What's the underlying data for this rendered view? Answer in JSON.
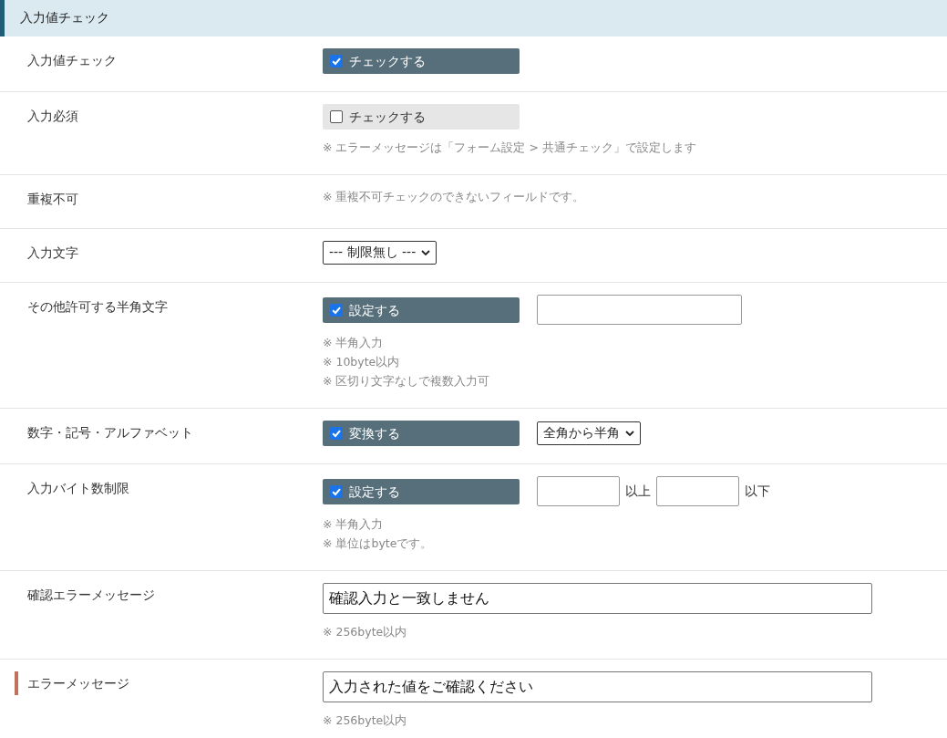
{
  "section": {
    "title": "入力値チェック"
  },
  "rows": [
    {
      "label": "入力値チェック",
      "required": false,
      "controls": [
        {
          "kind": "toggle",
          "label": "チェックする",
          "checked": true
        }
      ]
    },
    {
      "label": "入力必須",
      "required": false,
      "controls": [
        {
          "kind": "toggle",
          "label": "チェックする",
          "checked": false
        }
      ],
      "notes": [
        "※ エラーメッセージは「フォーム設定 > 共通チェック」で設定します"
      ]
    },
    {
      "label": "重複不可",
      "required": false,
      "notes": [
        "※ 重複不可チェックのできないフィールドです。"
      ]
    },
    {
      "label": "入力文字",
      "required": false,
      "controls": [
        {
          "kind": "select",
          "value": "--- 制限無し ---"
        }
      ]
    },
    {
      "label": "その他許可する半角文字",
      "required": false,
      "controls": [
        {
          "kind": "toggle",
          "label": "設定する",
          "checked": true
        },
        {
          "kind": "input"
        }
      ],
      "notes": [
        "※ 半角入力",
        "※ 10byte以内",
        "※ 区切り文字なしで複数入力可"
      ]
    },
    {
      "label": "数字・記号・アルファベット",
      "required": false,
      "controls": [
        {
          "kind": "toggle",
          "label": "変換する",
          "checked": true
        },
        {
          "kind": "select",
          "value": "全角から半角"
        }
      ]
    },
    {
      "label": "入力バイト数制限",
      "required": false,
      "controls": [
        {
          "kind": "toggle",
          "label": "設定する",
          "checked": true
        },
        {
          "kind": "short-input"
        },
        {
          "kind": "text",
          "text": "以上"
        },
        {
          "kind": "short-input"
        },
        {
          "kind": "text",
          "text": "以下"
        }
      ],
      "notes": [
        "※ 半角入力",
        "※ 単位はbyteです。"
      ]
    },
    {
      "label": "確認エラーメッセージ",
      "required": false,
      "controls": [
        {
          "kind": "wide-input",
          "value": "確認入力と一致しません"
        }
      ],
      "notes": [
        "※ 256byte以内"
      ]
    },
    {
      "label": "エラーメッセージ",
      "required": true,
      "controls": [
        {
          "kind": "wide-input",
          "value": "入力された値をご確認ください"
        }
      ],
      "notes": [
        "※ 256byte以内"
      ]
    }
  ]
}
